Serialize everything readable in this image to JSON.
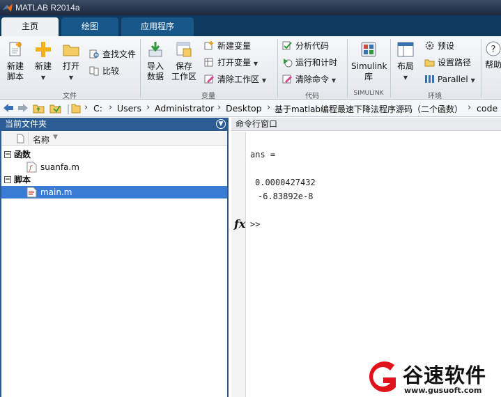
{
  "window": {
    "title": "MATLAB R2014a"
  },
  "tabs": [
    {
      "label": "主页",
      "active": true
    },
    {
      "label": "绘图",
      "active": false
    },
    {
      "label": "应用程序",
      "active": false
    }
  ],
  "ribbon": {
    "file_group": {
      "label": "文件",
      "new_script": "新建\n脚本",
      "new": "新建",
      "open": "打开",
      "find_files": "查找文件",
      "compare": "比较"
    },
    "variable_group": {
      "label": "变量",
      "import_data": "导入\n数据",
      "save_workspace": "保存\n工作区",
      "new_variable": "新建变量",
      "open_variable": "打开变量",
      "clear_workspace": "清除工作区"
    },
    "code_group": {
      "label": "代码",
      "analyze_code": "分析代码",
      "run_and_time": "运行和计时",
      "clear_commands": "清除命令"
    },
    "simulink_group": {
      "label": "SIMULINK",
      "simulink_library": "Simulink\n库"
    },
    "environment_group": {
      "label": "环境",
      "layout": "布局",
      "preferences": "预设",
      "set_path": "设置路径",
      "parallel": "Parallel"
    },
    "help": "帮助"
  },
  "address": {
    "path": [
      "C:",
      "Users",
      "Administrator",
      "Desktop",
      "基于matlab编程最速下降法程序源码（二个函数）",
      "code"
    ]
  },
  "current_folder": {
    "title": "当前文件夹",
    "column_name": "名称",
    "groups": [
      {
        "label": "函数",
        "files": [
          "suanfa.m"
        ]
      },
      {
        "label": "脚本",
        "files": [
          "main.m"
        ]
      }
    ],
    "selected_file": "main.m"
  },
  "command_window": {
    "title": "命令行窗口",
    "lines": [
      "ans =",
      "0.0000427432",
      "-6.83892e-8"
    ],
    "prompt": ">>"
  },
  "watermark": {
    "brand": "谷速软件",
    "url": "www.gusuoft.com"
  },
  "colors": {
    "accent": "#2b5d94",
    "tabstrip": "#0e3a5f",
    "selection": "#3a7bd5",
    "watermark_red": "#e0121b"
  }
}
